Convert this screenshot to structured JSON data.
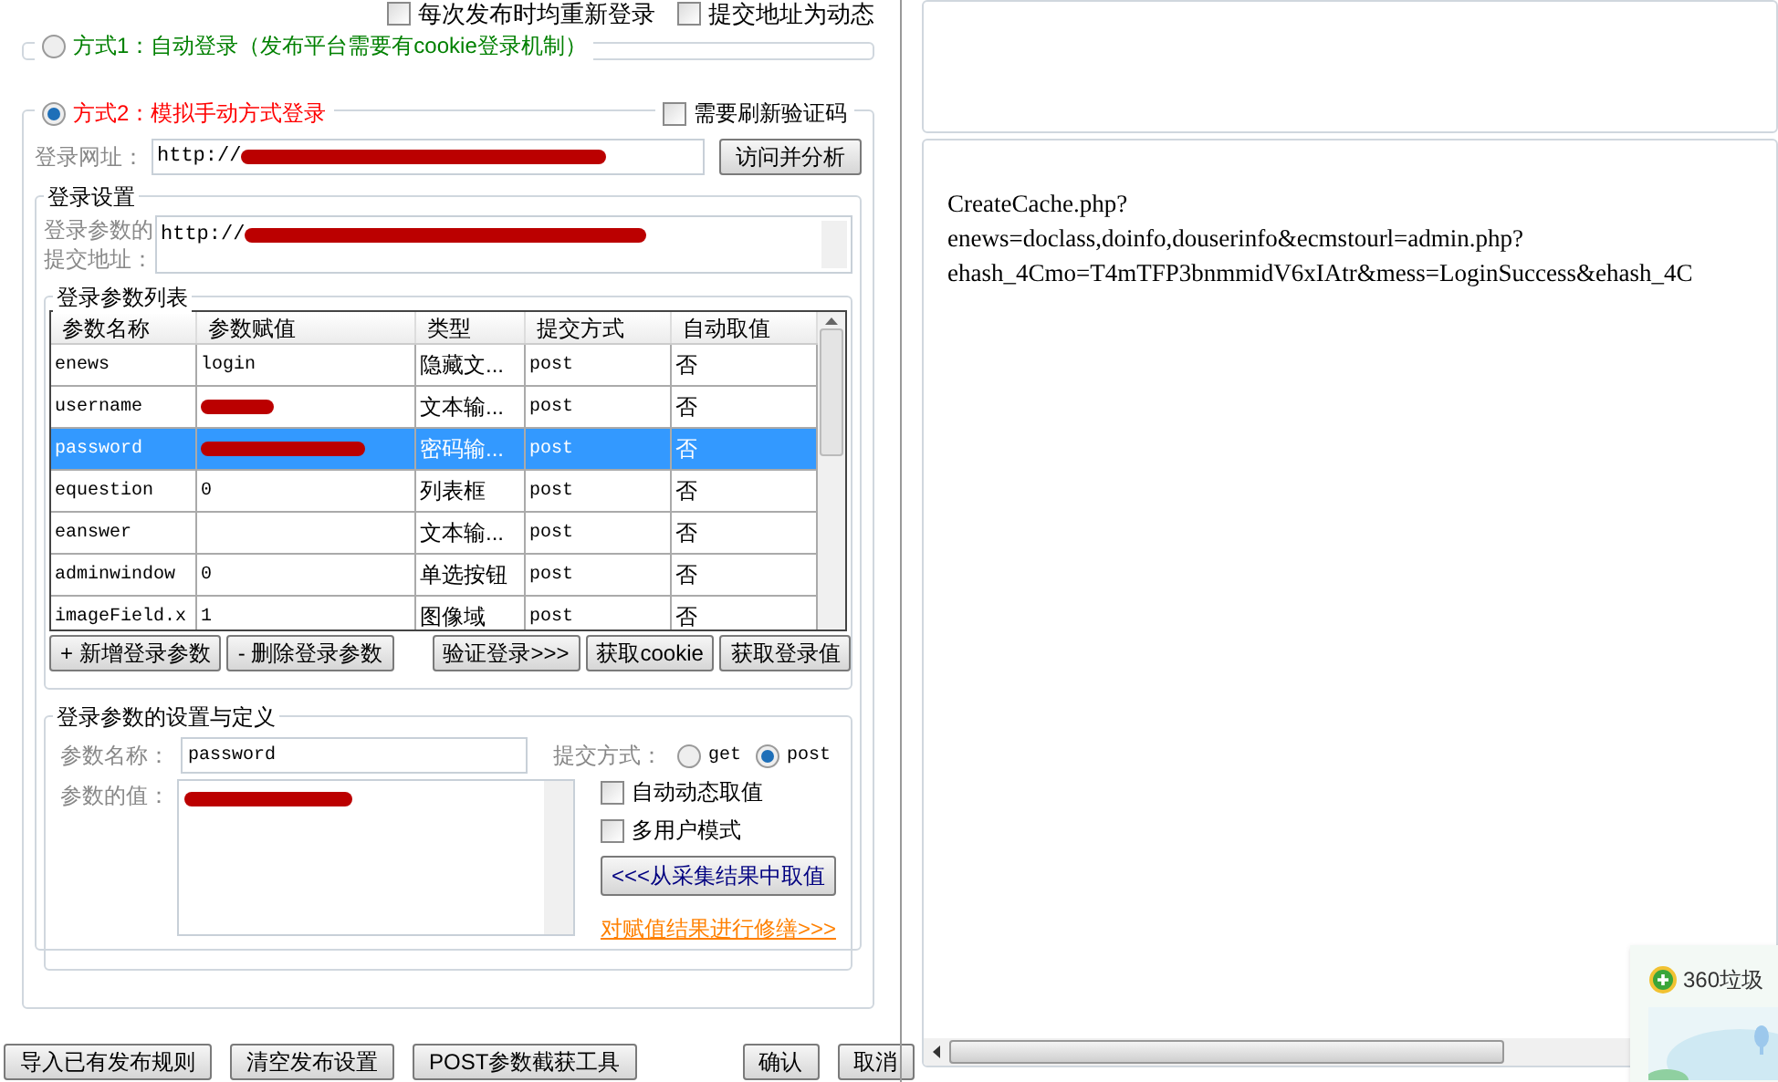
{
  "top_options": [
    {
      "label": "每次发布时均重新登录",
      "checked": false
    },
    {
      "label": "提交地址为动态",
      "checked": false
    }
  ],
  "mode1": {
    "label": "方式1：自动登录（发布平台需要有cookie登录机制）",
    "selected": false
  },
  "mode2": {
    "label": "方式2：模拟手动方式登录",
    "selected": true,
    "refresh_captcha": {
      "label": "需要刷新验证码",
      "checked": false
    },
    "url_label": "登录网址：",
    "url_value": "http://",
    "url_redacted": true,
    "analyze_button": "访问并分析",
    "settings": {
      "title": "登录设置",
      "submit_label": "登录参数的提交地址：",
      "submit_value": "http://",
      "submit_redacted": true
    },
    "params": {
      "title": "登录参数列表",
      "columns": [
        "参数名称",
        "参数赋值",
        "类型",
        "提交方式",
        "自动取值"
      ],
      "rows": [
        {
          "cells": [
            "enews",
            "login",
            "隐藏文...",
            "post",
            "否"
          ],
          "redacted": false,
          "selected": false
        },
        {
          "cells": [
            "username",
            "",
            "文本输...",
            "post",
            "否"
          ],
          "redacted": true,
          "selected": false
        },
        {
          "cells": [
            "password",
            "",
            "密码输...",
            "post",
            "否"
          ],
          "redacted": true,
          "selected": true
        },
        {
          "cells": [
            "equestion",
            "0",
            "列表框",
            "post",
            "否"
          ],
          "redacted": false,
          "selected": false
        },
        {
          "cells": [
            "eanswer",
            "",
            "文本输...",
            "post",
            "否"
          ],
          "redacted": false,
          "selected": false
        },
        {
          "cells": [
            "adminwindow",
            "0",
            "单选按钮",
            "post",
            "否"
          ],
          "redacted": false,
          "selected": false
        },
        {
          "cells": [
            "imageField.x",
            "1",
            "图像域",
            "post",
            "否"
          ],
          "redacted": false,
          "selected": false
        }
      ],
      "buttons": [
        {
          "label": "+ 新增登录参数",
          "kind": "left"
        },
        {
          "label": "- 删除登录参数",
          "kind": "left"
        },
        {
          "label": "验证登录>>>",
          "kind": "focus"
        },
        {
          "label": "获取cookie",
          "kind": "right"
        },
        {
          "label": "获取登录值",
          "kind": "right"
        }
      ]
    },
    "definition": {
      "title": "登录参数的设置与定义",
      "name_label": "参数名称：",
      "name_value": "password",
      "method_label": "提交方式：",
      "methods": [
        {
          "label": "get",
          "selected": false
        },
        {
          "label": "post",
          "selected": true
        }
      ],
      "value_label": "参数的值：",
      "value_redacted": true,
      "options": [
        {
          "label": "自动动态取值",
          "checked": false
        },
        {
          "label": "多用户模式",
          "checked": false
        }
      ],
      "fetch_button": "<<<从采集结果中取值",
      "trim_link": "对赋值结果进行修缮>>>"
    }
  },
  "bottom_buttons": [
    {
      "label": "导入已有发布规则",
      "kind": "left"
    },
    {
      "label": "清空发布设置",
      "kind": "left"
    },
    {
      "label": "POST参数截获工具",
      "kind": "left"
    },
    {
      "label": "确认",
      "kind": "right"
    },
    {
      "label": "取消",
      "kind": "right"
    }
  ],
  "result_lines": [
    "CreateCache.php?",
    "enews=doclass,doinfo,douserinfo&ecmstourl=admin.php?",
    "ehash_4Cmo=T4mTFP3bnmmidV6xIAtr&mess=LoginSuccess&ehash_4C"
  ],
  "popup": {
    "title": "360垃圾"
  }
}
